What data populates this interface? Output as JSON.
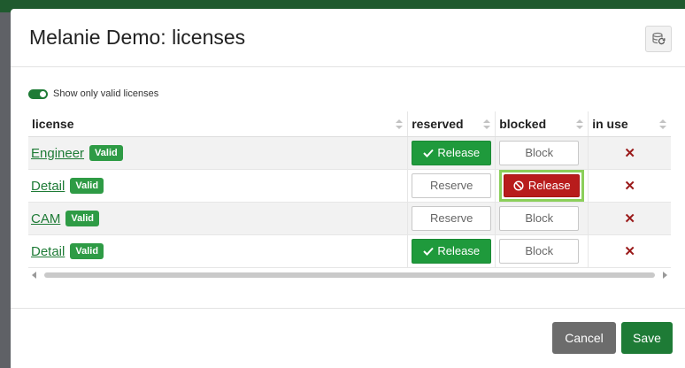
{
  "dialog": {
    "title": "Melanie Demo: licenses",
    "refresh_icon": "refresh-database-icon"
  },
  "filter": {
    "label": "Show only valid licenses",
    "enabled": true
  },
  "columns": {
    "license": "license",
    "reserved": "reserved",
    "blocked": "blocked",
    "in_use": "in use"
  },
  "rows": [
    {
      "name": "Engineer",
      "status": "Valid",
      "reserved_label": "Release",
      "reserved_icon": "check-icon",
      "reserved_state": "active",
      "blocked_label": "Block",
      "blocked_state": "default",
      "in_use": "✕"
    },
    {
      "name": "Detail",
      "status": "Valid",
      "reserved_label": "Reserve",
      "reserved_state": "default",
      "blocked_label": "Release",
      "blocked_icon": "ban-icon",
      "blocked_state": "active",
      "in_use": "✕"
    },
    {
      "name": "CAM",
      "status": "Valid",
      "reserved_label": "Reserve",
      "reserved_state": "default",
      "blocked_label": "Block",
      "blocked_state": "default",
      "in_use": "✕"
    },
    {
      "name": "Detail",
      "status": "Valid",
      "reserved_label": "Release",
      "reserved_icon": "check-icon",
      "reserved_state": "active",
      "blocked_label": "Block",
      "blocked_state": "default",
      "in_use": "✕"
    }
  ],
  "footer": {
    "cancel_label": "Cancel",
    "save_label": "Save"
  },
  "colors": {
    "primary_green": "#1e7b36",
    "valid_badge": "#2e9b45",
    "release_green": "#1f9a3c",
    "block_red": "#b81c1c",
    "highlight": "#8bcf5a"
  }
}
